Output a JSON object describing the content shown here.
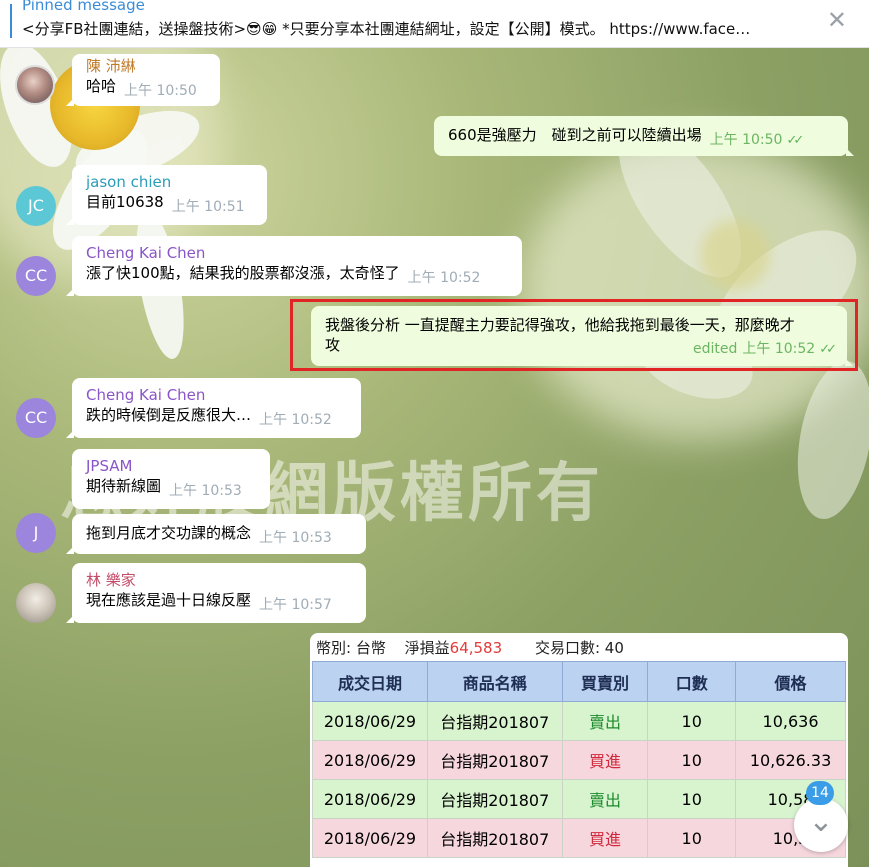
{
  "pinned": {
    "title": "Pinned message",
    "text": "<分享FB社團連結，送操盤技術>😎😁 *只要分享本社團連結網址，設定【公開】模式。 https://www.face…",
    "close": "✕"
  },
  "watermark": "息好股網版權所有",
  "messages": [
    {
      "sender": "陳 沛綝",
      "text": "哈哈",
      "time": "上午 10:50"
    },
    {
      "text": "660是強壓力　碰到之前可以陸續出場",
      "time": "上午 10:50",
      "checks": "✓✓"
    },
    {
      "sender": "jason chien",
      "text": "目前10638",
      "time": "上午 10:51",
      "avatar": "JC"
    },
    {
      "sender": "Cheng Kai Chen",
      "text": "漲了快100點，結果我的股票都沒漲，太奇怪了",
      "time": "上午 10:52",
      "avatar": "CC"
    },
    {
      "line1": "我盤後分析  一直提醒主力要記得強攻，他給我拖到最後一天，那麼晚才",
      "line2": "攻",
      "edited": "edited",
      "time": "上午 10:52",
      "checks": "✓✓"
    },
    {
      "sender": "Cheng Kai Chen",
      "text": "跌的時候倒是反應很大…",
      "time": "上午 10:52",
      "avatar": "CC"
    },
    {
      "sender": "JPSAM",
      "text": "期待新線圖",
      "time": "上午 10:53"
    },
    {
      "text": "拖到月底才交功課的概念",
      "time": "上午 10:53",
      "avatar": "J"
    },
    {
      "sender": "林 樂家",
      "text": "現在應該是過十日線反壓",
      "time": "上午 10:57"
    }
  ],
  "colors": {
    "sender_brown": "#c07a2a",
    "sender_teal": "#2a9db8",
    "sender_purple": "#8a55c8",
    "sender_jpsam": "#8a55c8",
    "sender_lin": "#c24d6a",
    "avatar_jc": "#5cc8d6",
    "avatar_cc": "#9c85dd",
    "avatar_j": "#9c85dd"
  },
  "trade_card": {
    "currency_label": "幣別:",
    "currency": "台幣",
    "pnl_label": "淨損益",
    "pnl": "64,583",
    "lots_label": "交易口數:",
    "lots": "40",
    "headers": [
      "成交日期",
      "商品名稱",
      "買賣別",
      "口數",
      "價格"
    ],
    "rows": [
      [
        "2018/06/29",
        "台指期201807",
        "賣出",
        "10",
        "10,636"
      ],
      [
        "2018/06/29",
        "台指期201807",
        "買進",
        "10",
        "10,626.33"
      ],
      [
        "2018/06/29",
        "台指期201807",
        "賣出",
        "10",
        "10,58"
      ],
      [
        "2018/06/29",
        "台指期201807",
        "買進",
        "10",
        "10,5"
      ]
    ]
  },
  "unread_badge": "14",
  "scroll_icon": "⌄"
}
